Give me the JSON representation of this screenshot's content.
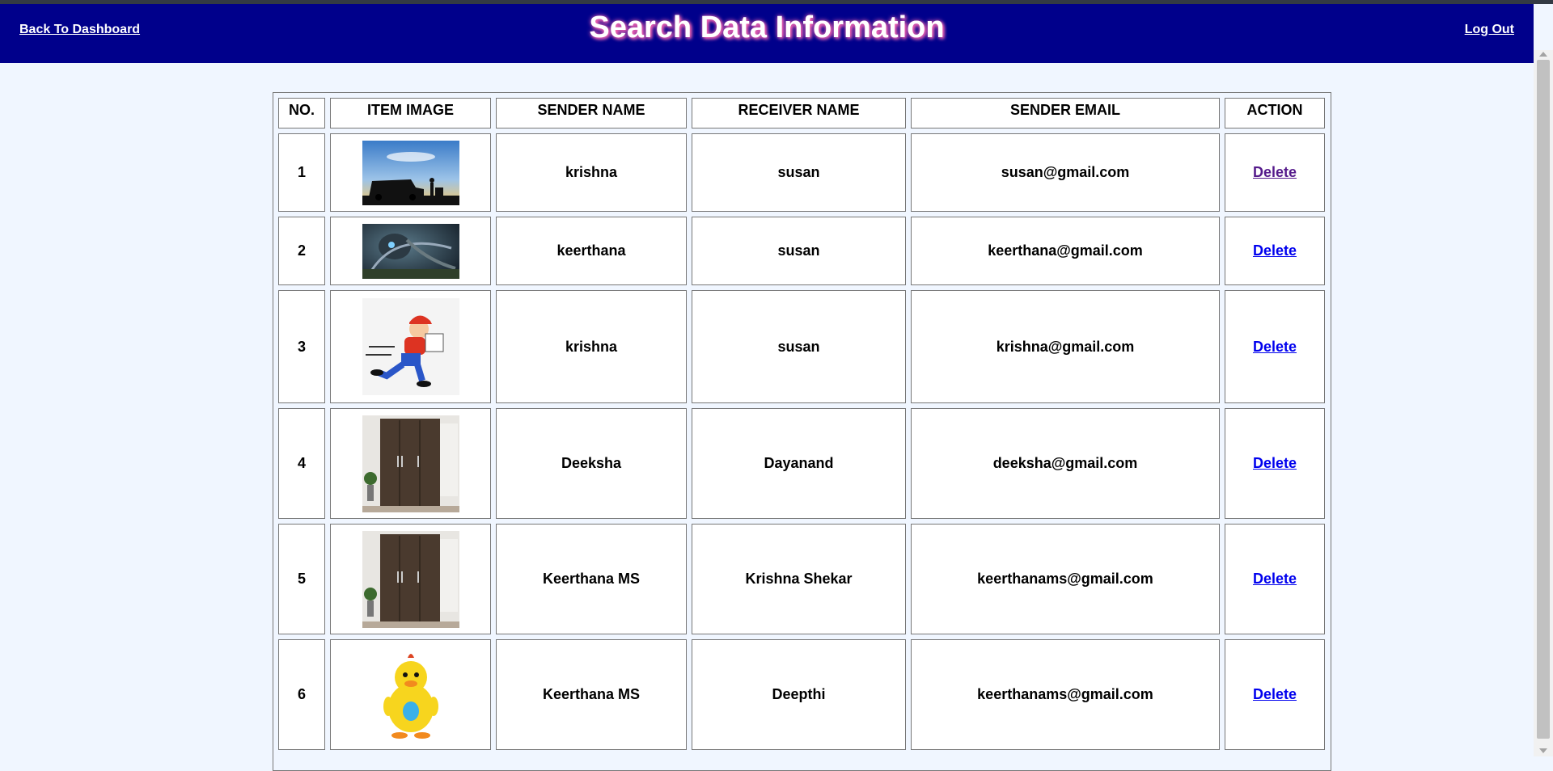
{
  "header": {
    "back_label": "Back To Dashboard",
    "title": "Search Data Information",
    "logout_label": "Log Out"
  },
  "table": {
    "columns": [
      "NO.",
      "ITEM IMAGE",
      "SENDER NAME",
      "RECEIVER NAME",
      "SENDER EMAIL",
      "ACTION"
    ],
    "rows": [
      {
        "no": "1",
        "image": "delivery-van-sunset-icon",
        "sender": "krishna",
        "receiver": "susan",
        "email": "susan@gmail.com",
        "action": "Delete"
      },
      {
        "no": "2",
        "image": "robot-creature-art-icon",
        "sender": "keerthana",
        "receiver": "susan",
        "email": "keerthana@gmail.com",
        "action": "Delete"
      },
      {
        "no": "3",
        "image": "cartoon-delivery-man-icon",
        "sender": "krishna",
        "receiver": "susan",
        "email": "krishna@gmail.com",
        "action": "Delete"
      },
      {
        "no": "4",
        "image": "wooden-wardrobe-icon",
        "sender": "Deeksha",
        "receiver": "Dayanand",
        "email": "deeksha@gmail.com",
        "action": "Delete"
      },
      {
        "no": "5",
        "image": "wooden-wardrobe-icon",
        "sender": "Keerthana MS",
        "receiver": "Krishna Shekar",
        "email": "keerthanams@gmail.com",
        "action": "Delete"
      },
      {
        "no": "6",
        "image": "yellow-duck-toy-icon",
        "sender": "Keerthana MS",
        "receiver": "Deepthi",
        "email": "keerthanams@gmail.com",
        "action": "Delete"
      }
    ]
  },
  "colors": {
    "header_bg": "#00008b",
    "page_bg": "#f0f6ff",
    "title_glow": "#ff69b4",
    "link": "#0000ee",
    "visited_link": "#551a8b"
  }
}
